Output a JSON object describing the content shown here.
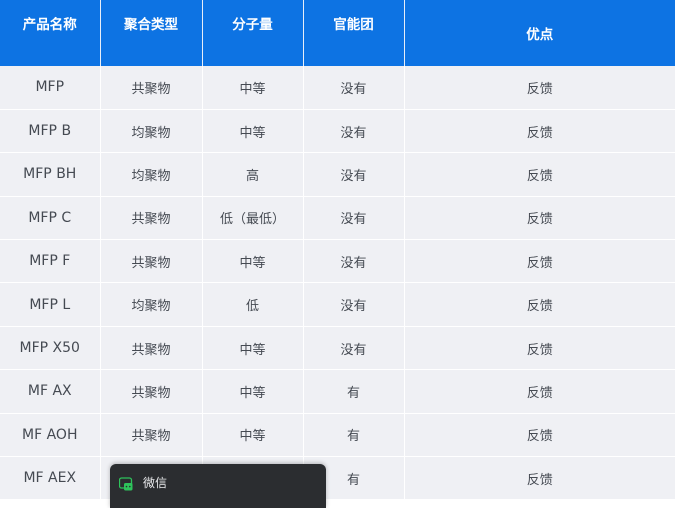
{
  "table": {
    "headers": [
      "产品名称",
      "聚合类型",
      "分子量",
      "官能团",
      "优点"
    ],
    "rows": [
      [
        "MFP",
        "共聚物",
        "中等",
        "没有",
        "反馈"
      ],
      [
        "MFP B",
        "均聚物",
        "中等",
        "没有",
        "反馈"
      ],
      [
        "MFP BH",
        "均聚物",
        "高",
        "没有",
        "反馈"
      ],
      [
        "MFP C",
        "共聚物",
        "低（最低）",
        "没有",
        "反馈"
      ],
      [
        "MFP F",
        "共聚物",
        "中等",
        "没有",
        "反馈"
      ],
      [
        "MFP L",
        "均聚物",
        "低",
        "没有",
        "反馈"
      ],
      [
        "MFP X50",
        "共聚物",
        "中等",
        "没有",
        "反馈"
      ],
      [
        "MF AX",
        "共聚物",
        "中等",
        "有",
        "反馈"
      ],
      [
        "MF AOH",
        "共聚物",
        "中等",
        "有",
        "反馈"
      ],
      [
        "MF AEX",
        "",
        "",
        "有",
        "反馈"
      ]
    ]
  },
  "taskbar_popup": {
    "label": "微信",
    "icon": "wechat-icon"
  },
  "colors": {
    "header_bg": "#0d73e3",
    "row_bg": "#eff0f4",
    "popup_bg": "#2b2d30",
    "wechat_green": "#2ec35b"
  }
}
